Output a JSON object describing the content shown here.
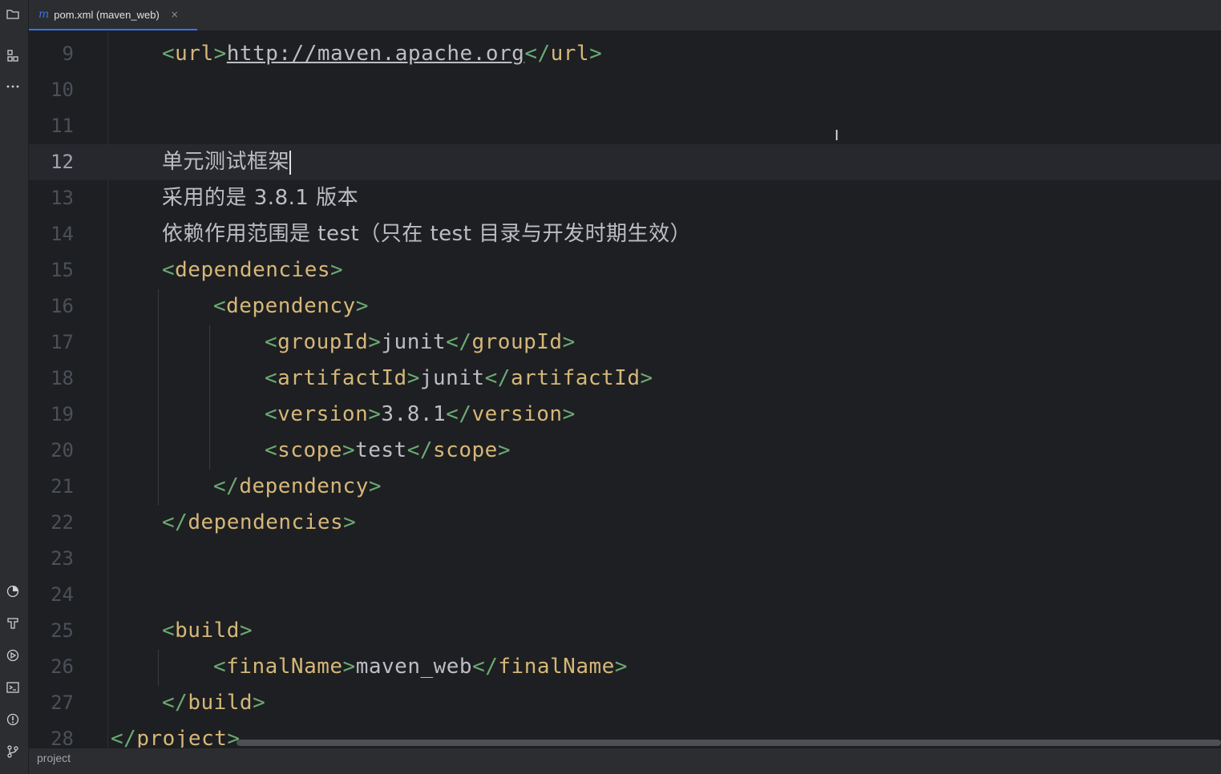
{
  "tab": {
    "icon_letter": "m",
    "label": "pom.xml (maven_web)",
    "close": "×"
  },
  "left_tools": [
    "project-folder-icon",
    "structure-icon",
    "more-icon",
    "profiler-icon",
    "build-icon",
    "services-icon",
    "terminal-icon",
    "problems-icon",
    "git-icon"
  ],
  "editor": {
    "current_line": "12",
    "lines": [
      {
        "num": "9",
        "a": "<",
        "b": "url",
        "c": ">",
        "d": "http://maven.apache.org",
        "e": "</",
        "f": "url",
        "g": ">"
      },
      {
        "num": "10"
      },
      {
        "num": "11"
      },
      {
        "num": "12",
        "text": "单元测试框架"
      },
      {
        "num": "13",
        "text": "采用的是 3.8.1 版本"
      },
      {
        "num": "14",
        "text": "依赖作用范围是 test（只在 test 目录与开发时期生效）"
      },
      {
        "num": "15",
        "a": "<",
        "b": "dependencies",
        "c": ">"
      },
      {
        "num": "16",
        "a": "<",
        "b": "dependency",
        "c": ">"
      },
      {
        "num": "17",
        "a": "<",
        "b": "groupId",
        "c": ">",
        "d": "junit",
        "e": "</",
        "f": "groupId",
        "g": ">"
      },
      {
        "num": "18",
        "a": "<",
        "b": "artifactId",
        "c": ">",
        "d": "junit",
        "e": "</",
        "f": "artifactId",
        "g": ">"
      },
      {
        "num": "19",
        "a": "<",
        "b": "version",
        "c": ">",
        "d": "3.8.1",
        "e": "</",
        "f": "version",
        "g": ">"
      },
      {
        "num": "20",
        "a": "<",
        "b": "scope",
        "c": ">",
        "d": "test",
        "e": "</",
        "f": "scope",
        "g": ">"
      },
      {
        "num": "21",
        "a": "</",
        "b": "dependency",
        "c": ">"
      },
      {
        "num": "22",
        "a": "</",
        "b": "dependencies",
        "c": ">"
      },
      {
        "num": "23"
      },
      {
        "num": "24"
      },
      {
        "num": "25",
        "a": "<",
        "b": "build",
        "c": ">"
      },
      {
        "num": "26",
        "a": "<",
        "b": "finalName",
        "c": ">",
        "d": "maven_web",
        "e": "</",
        "f": "finalName",
        "g": ">"
      },
      {
        "num": "27",
        "a": "</",
        "b": "build",
        "c": ">"
      },
      {
        "num": "28",
        "a": "</",
        "b": "project",
        "c": ">"
      }
    ]
  },
  "status": {
    "breadcrumb": "project"
  },
  "colors": {
    "background": "#1e1f22",
    "panel": "#2b2d30",
    "accent": "#3574f0",
    "tag_bracket": "#6aab73",
    "tag_name": "#d5b778",
    "text": "#bcbec4",
    "line_number": "#4b5059"
  }
}
